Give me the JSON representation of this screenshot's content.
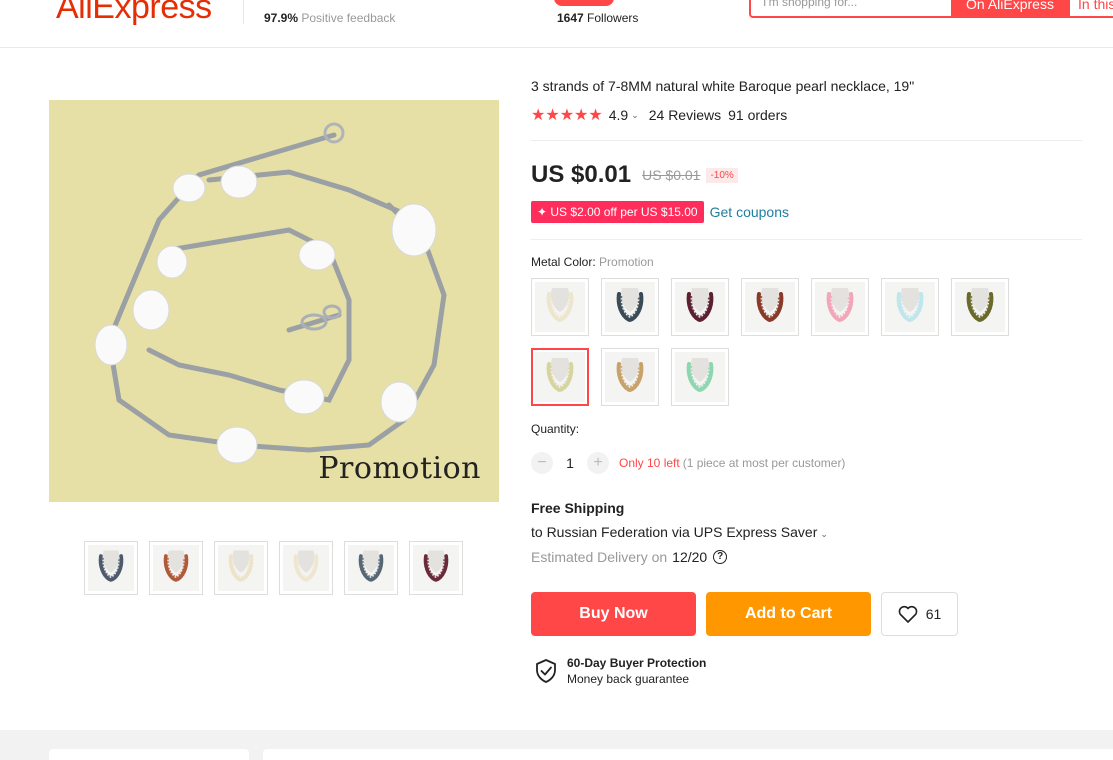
{
  "header": {
    "logo": "AliExpress",
    "positive_pct": "97.9%",
    "positive_label": " Positive feedback",
    "followers_count": "1647",
    "followers_label": " Followers",
    "search_placeholder": "I'm shopping for...",
    "search_ali": "On AliExpress",
    "search_store": "In this store"
  },
  "product": {
    "title": "3 strands of 7-8MM natural white Baroque pearl necklace, 19\"",
    "rating": "4.9",
    "reviews": "24 Reviews",
    "orders": "91 orders",
    "price": "US $0.01",
    "original_price": "US $0.01",
    "discount": "-10%",
    "coupon": "✦ US $2.00 off per US $15.00",
    "get_coupons": "Get coupons",
    "metal_color_label": "Metal Color: ",
    "metal_color_value": "Promotion",
    "main_image_caption": "Promotion",
    "quantity_label": "Quantity:",
    "quantity": "1",
    "stock": "Only 10 left",
    "limit": "(1 piece at most per customer)",
    "free_shipping": "Free Shipping",
    "ship_to": "to Russian Federation via UPS Express Saver",
    "est_delivery_label": "Estimated Delivery on",
    "est_delivery_date": "12/20",
    "buy_now": "Buy Now",
    "add_to_cart": "Add to Cart",
    "wishlist_count": "61",
    "protection_title": "60-Day Buyer Protection",
    "protection_sub": "Money back guarantee"
  },
  "gallery_thumbs": [
    {
      "color": "#4f5b6b"
    },
    {
      "color": "#b05a3a"
    },
    {
      "color": "#ece3c9"
    },
    {
      "color": "#efe6cf"
    },
    {
      "color": "#566875"
    },
    {
      "color": "#6a2a3a"
    }
  ],
  "color_swatches": [
    {
      "color": "#eee6cc",
      "selected": false
    },
    {
      "color": "#3a4a56",
      "selected": false
    },
    {
      "color": "#5d2030",
      "selected": false
    },
    {
      "color": "#8a3a28",
      "selected": false
    },
    {
      "color": "#f2a6b8",
      "selected": false
    },
    {
      "color": "#bfe6ea",
      "selected": false
    },
    {
      "color": "#6b6a2a",
      "selected": false
    },
    {
      "color": "#d8d4a0",
      "selected": true
    },
    {
      "color": "#c9a26a",
      "selected": false
    },
    {
      "color": "#8fd6b0",
      "selected": false
    }
  ],
  "colors": {
    "accent": "#ff4747",
    "cart": "#ff9800",
    "link": "#1e7f9e",
    "coupon": "#ff2d5b"
  }
}
